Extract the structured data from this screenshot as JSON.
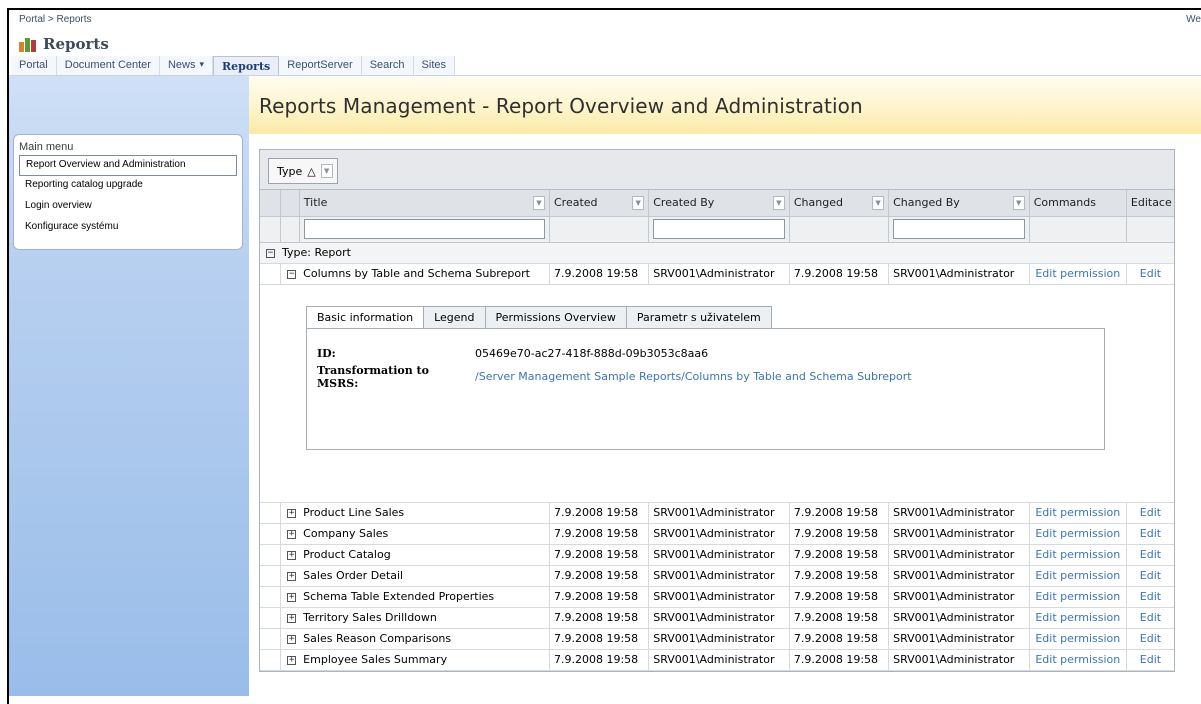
{
  "topbar": {
    "breadcrumb": "Portal > Reports",
    "welcome": "We"
  },
  "site": {
    "title": "Reports"
  },
  "nav": {
    "tabs": [
      {
        "label": "Portal"
      },
      {
        "label": "Document Center"
      },
      {
        "label": "News",
        "dropdown": "▾"
      },
      {
        "label": "Reports",
        "active": true
      },
      {
        "label": "ReportServer"
      },
      {
        "label": "Search"
      },
      {
        "label": "Sites"
      }
    ]
  },
  "sidebar": {
    "title": "Main menu",
    "items": [
      {
        "label": "Report Overview and Administration",
        "selected": true
      },
      {
        "label": "Reporting catalog upgrade"
      },
      {
        "label": "Login overview"
      },
      {
        "label": "Konfigurace systému"
      }
    ]
  },
  "page": {
    "title": "Reports Management - Report Overview and Administration"
  },
  "grid": {
    "group_chip": {
      "label": "Type",
      "sort": "△"
    },
    "columns": {
      "title": "Title",
      "created": "Created",
      "created_by": "Created By",
      "changed": "Changed",
      "changed_by": "Changed By",
      "commands": "Commands",
      "edit": "Editace"
    },
    "group": {
      "label": "Type: Report"
    },
    "expanded_row": {
      "title": "Columns by Table and Schema Subreport",
      "created": "7.9.2008 19:58",
      "created_by": "SRV001\\Administrator",
      "changed": "7.9.2008 19:58",
      "changed_by": "SRV001\\Administrator",
      "command": "Edit permission",
      "edit": "Edit"
    },
    "detail": {
      "tabs": [
        "Basic information",
        "Legend",
        "Permissions Overview",
        "Parametr s uživatelem"
      ],
      "id_label": "ID:",
      "id_value": "05469e70-ac27-418f-888d-09b3053c8aa6",
      "msrs_label_1": "Transformation to",
      "msrs_label_2": "MSRS:",
      "msrs_value": "/Server Management Sample Reports/Columns by Table and Schema Subreport"
    },
    "rows": [
      {
        "title": "Product Line Sales",
        "created": "7.9.2008 19:58",
        "created_by": "SRV001\\Administrator",
        "changed": "7.9.2008 19:58",
        "changed_by": "SRV001\\Administrator",
        "command": "Edit permission",
        "edit": "Edit"
      },
      {
        "title": "Company Sales",
        "created": "7.9.2008 19:58",
        "created_by": "SRV001\\Administrator",
        "changed": "7.9.2008 19:58",
        "changed_by": "SRV001\\Administrator",
        "command": "Edit permission",
        "edit": "Edit"
      },
      {
        "title": "Product Catalog",
        "created": "7.9.2008 19:58",
        "created_by": "SRV001\\Administrator",
        "changed": "7.9.2008 19:58",
        "changed_by": "SRV001\\Administrator",
        "command": "Edit permission",
        "edit": "Edit"
      },
      {
        "title": "Sales Order Detail",
        "created": "7.9.2008 19:58",
        "created_by": "SRV001\\Administrator",
        "changed": "7.9.2008 19:58",
        "changed_by": "SRV001\\Administrator",
        "command": "Edit permission",
        "edit": "Edit"
      },
      {
        "title": "Schema Table Extended Properties",
        "created": "7.9.2008 19:58",
        "created_by": "SRV001\\Administrator",
        "changed": "7.9.2008 19:58",
        "changed_by": "SRV001\\Administrator",
        "command": "Edit permission",
        "edit": "Edit"
      },
      {
        "title": "Territory Sales Drilldown",
        "created": "7.9.2008 19:58",
        "created_by": "SRV001\\Administrator",
        "changed": "7.9.2008 19:58",
        "changed_by": "SRV001\\Administrator",
        "command": "Edit permission",
        "edit": "Edit"
      },
      {
        "title": "Sales Reason Comparisons",
        "created": "7.9.2008 19:58",
        "created_by": "SRV001\\Administrator",
        "changed": "7.9.2008 19:58",
        "changed_by": "SRV001\\Administrator",
        "command": "Edit permission",
        "edit": "Edit"
      },
      {
        "title": "Employee Sales Summary",
        "created": "7.9.2008 19:58",
        "created_by": "SRV001\\Administrator",
        "changed": "7.9.2008 19:58",
        "changed_by": "SRV001\\Administrator",
        "command": "Edit permission",
        "edit": "Edit"
      }
    ]
  },
  "colors": {
    "link": "#3d74b3",
    "banner": "#fce9a7",
    "sidebar": "#99bde9"
  }
}
